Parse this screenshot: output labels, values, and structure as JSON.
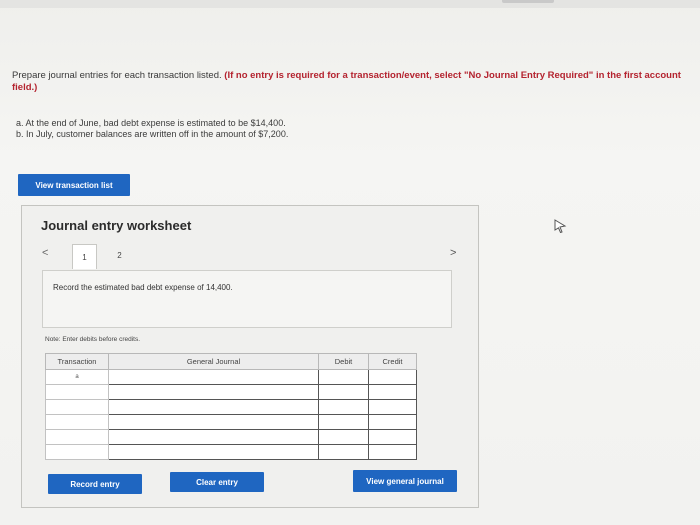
{
  "instructions": {
    "text_plain": "Prepare journal entries for each transaction listed. ",
    "text_bold": "(If no entry is required for a transaction/event, select \"No Journal Entry Required\" in the first account field.)"
  },
  "transactions": [
    "a. At the end of June, bad debt expense is estimated to be $14,400.",
    "b. In July, customer balances are written off in the amount of $7,200."
  ],
  "buttons": {
    "view_transaction_list": "View transaction list",
    "record_entry": "Record entry",
    "clear_entry": "Clear entry",
    "view_general_journal": "View general journal"
  },
  "worksheet": {
    "title": "Journal entry worksheet",
    "prev_label": "<",
    "next_label": ">",
    "pages": [
      "1",
      "2"
    ],
    "description": "Record the estimated bad debt expense of 14,400.",
    "note": "Note: Enter debits before credits."
  },
  "table": {
    "headers": [
      "Transaction",
      "General Journal",
      "Debit",
      "Credit"
    ],
    "rows": [
      [
        "a",
        "",
        "",
        ""
      ],
      [
        "",
        "",
        "",
        ""
      ],
      [
        "",
        "",
        "",
        ""
      ],
      [
        "",
        "",
        "",
        ""
      ],
      [
        "",
        "",
        "",
        ""
      ],
      [
        "",
        "",
        "",
        ""
      ]
    ]
  },
  "colors": {
    "button_blue": "#1f66c1",
    "instruction_red": "#b4232f"
  },
  "icons": {
    "cursor": "mouse-pointer-icon"
  }
}
